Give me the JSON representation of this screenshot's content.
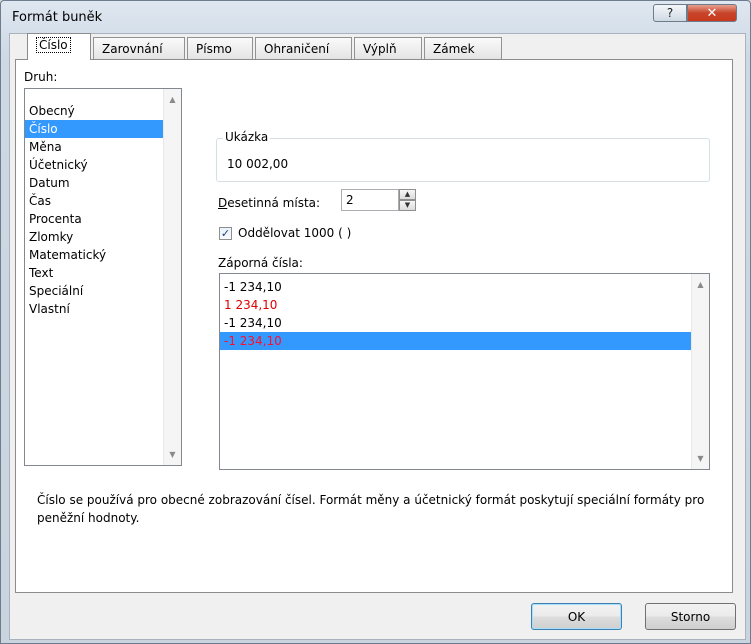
{
  "window": {
    "title": "Formát buněk",
    "help_glyph": "?",
    "close_glyph": "✕"
  },
  "tabs": [
    {
      "label": "Číslo",
      "active": true
    },
    {
      "label": "Zarovnání"
    },
    {
      "label": "Písmo"
    },
    {
      "label": "Ohraničení"
    },
    {
      "label": "Výplň"
    },
    {
      "label": "Zámek"
    }
  ],
  "category": {
    "label": "Druh:",
    "items": [
      "Obecný",
      "Číslo",
      "Měna",
      "Účetnický",
      "Datum",
      "Čas",
      "Procenta",
      "Zlomky",
      "Matematický",
      "Text",
      "Speciální",
      "Vlastní"
    ],
    "selected": "Číslo"
  },
  "sample": {
    "label": "Ukázka",
    "value": "10 002,00"
  },
  "decimal_places": {
    "label": "Desetinná místa:",
    "value": "2"
  },
  "thousands_separator": {
    "label": "Oddělovat 1000 ( )",
    "checked": true,
    "check_glyph": "✓"
  },
  "negative_numbers": {
    "label": "Záporná čísla:",
    "items": [
      {
        "text": "-1 234,10",
        "color": "#000000"
      },
      {
        "text": "1 234,10",
        "color": "#e00000"
      },
      {
        "text": "-1 234,10",
        "color": "#000000"
      },
      {
        "text": "-1 234,10",
        "color": "#ff0d2a",
        "selected": true
      }
    ]
  },
  "description": "Číslo se používá pro obecné zobrazování čísel. Formát měny a účetnický formát poskytují speciální formáty pro peněžní hodnoty.",
  "buttons": {
    "ok": "OK",
    "cancel": "Storno"
  },
  "icons": {
    "scroll_up": "▲",
    "scroll_down": "▼",
    "spin_up": "▲",
    "spin_down": "▼"
  },
  "colors": {
    "selection": "#3399ff",
    "red_text": "#e00000",
    "close_button": "#c7452b"
  }
}
